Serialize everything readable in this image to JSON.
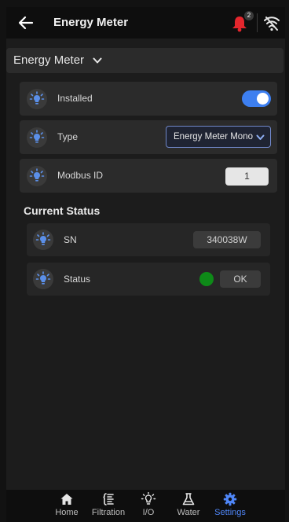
{
  "header": {
    "title": "Energy Meter",
    "notification_count": "2",
    "icons": {
      "back": "arrow-left-icon",
      "bell": "bell-icon",
      "wifi": "wifi-off-icon"
    }
  },
  "section": {
    "title": "Energy Meter"
  },
  "settings": [
    {
      "label": "Installed",
      "control": "toggle",
      "value": true
    },
    {
      "label": "Type",
      "control": "select",
      "value": "Energy Meter Mono"
    },
    {
      "label": "Modbus ID",
      "control": "input",
      "value": "1"
    }
  ],
  "current_status": {
    "title": "Current Status",
    "rows": [
      {
        "label": "SN",
        "value": "340038W"
      },
      {
        "label": "Status",
        "value": "OK",
        "indicator_color": "#0e8a18"
      }
    ]
  },
  "nav": {
    "items": [
      {
        "label": "Home",
        "icon": "home-icon"
      },
      {
        "label": "Filtration",
        "icon": "filtration-icon"
      },
      {
        "label": "I/O",
        "icon": "lightbulb-icon"
      },
      {
        "label": "Water",
        "icon": "flask-icon"
      },
      {
        "label": "Settings",
        "icon": "gear-icon",
        "active": true
      }
    ]
  },
  "colors": {
    "accent": "#3d7ff0",
    "alert": "#e5262d",
    "status_ok": "#0e8a18",
    "background": "#1c1c1c"
  }
}
